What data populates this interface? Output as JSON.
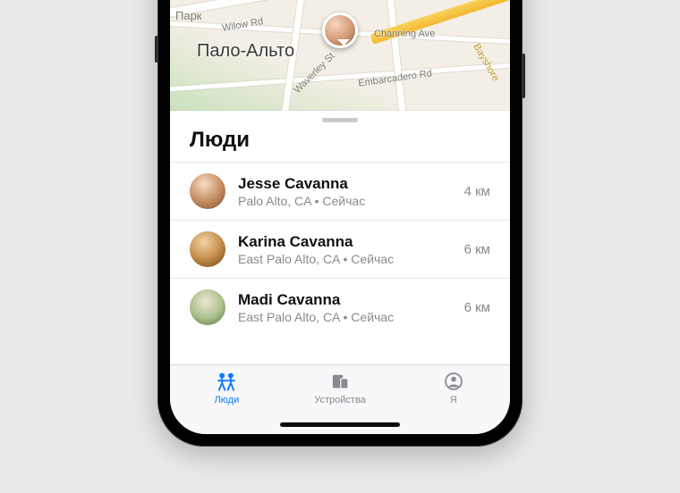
{
  "map": {
    "city": "Пало-Альто",
    "labels": {
      "park": "Парк",
      "wilow": "Wilow Rd",
      "channing": "Channing Ave",
      "waverley": "Waverley St",
      "embarcadero": "Embarcadero Rd",
      "bayshore": "Bayshore"
    }
  },
  "sheet": {
    "title": "Люди",
    "people": [
      {
        "name": "Jesse Cavanna",
        "sub": "Palo Alto, CA • Сейчас",
        "distance": "4 км"
      },
      {
        "name": "Karina Cavanna",
        "sub": "East Palo Alto, CA • Сейчас",
        "distance": "6 км"
      },
      {
        "name": "Madi Cavanna",
        "sub": "East Palo Alto, CA • Сейчас",
        "distance": "6 км"
      }
    ]
  },
  "tabs": {
    "people": "Люди",
    "devices": "Устройства",
    "me": "Я"
  }
}
